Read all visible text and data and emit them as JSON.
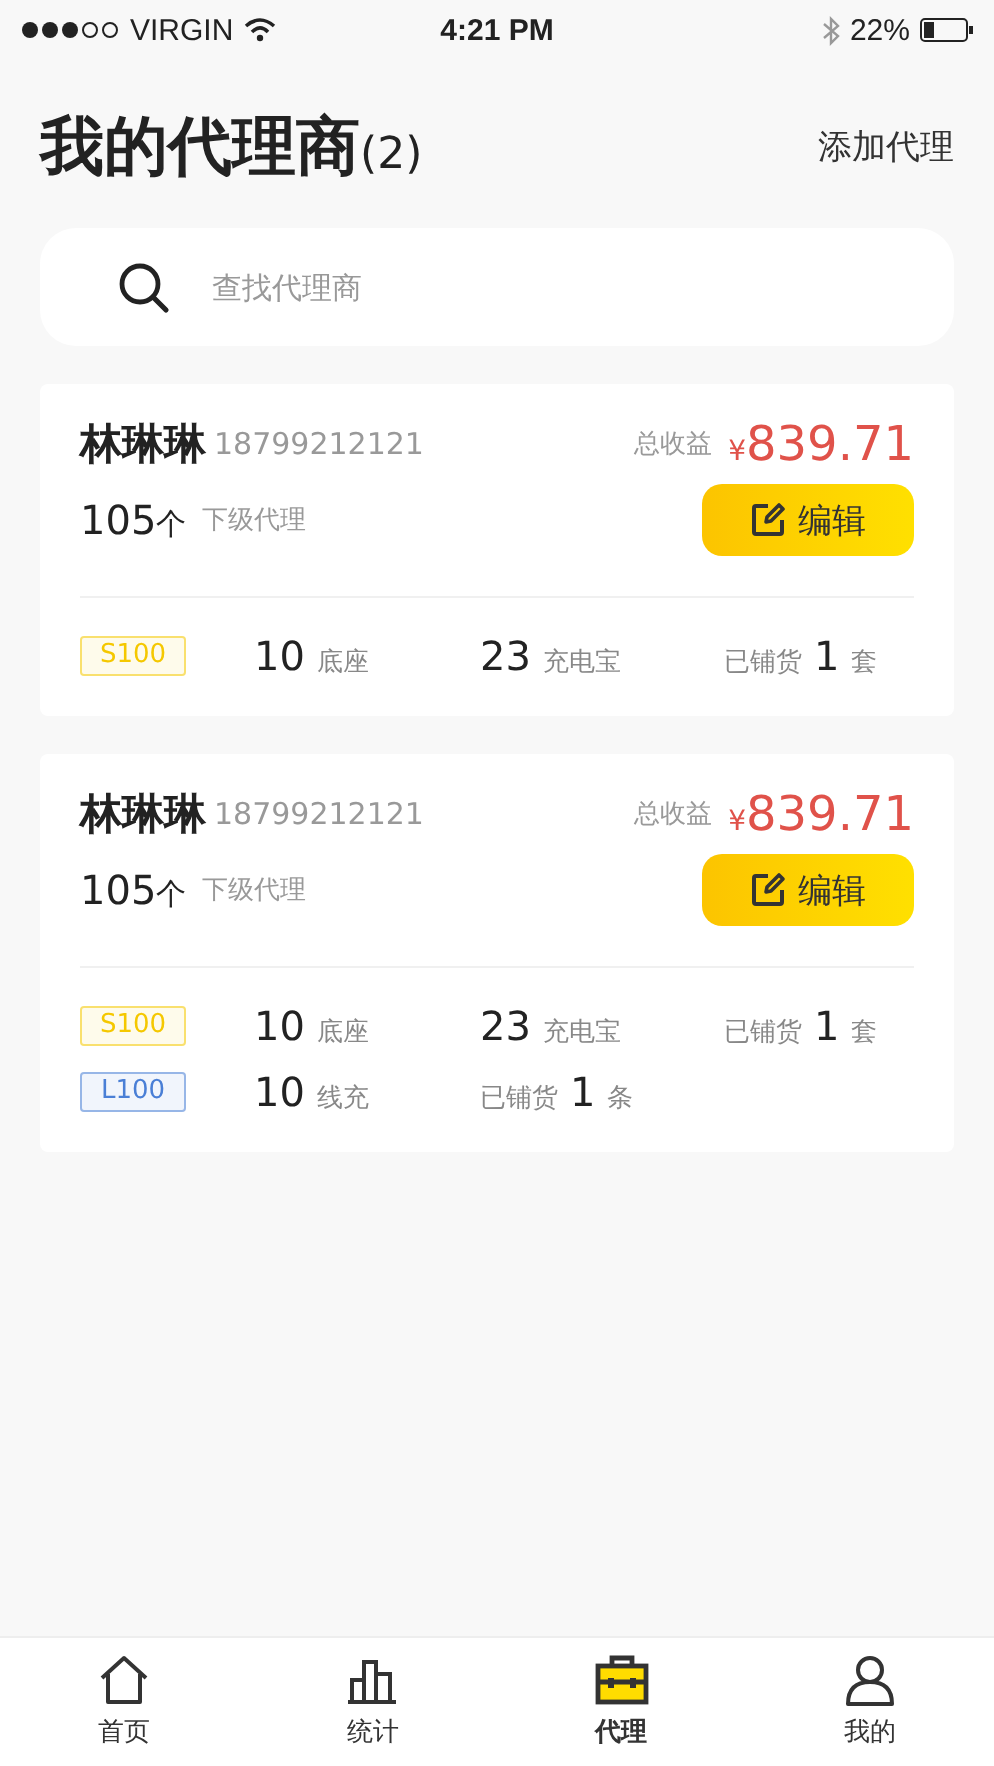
{
  "status_bar": {
    "carrier": "VIRGIN",
    "time": "4:21 PM",
    "battery": "22%"
  },
  "header": {
    "title": "我的代理商",
    "count": "(2)",
    "action": "添加代理"
  },
  "search": {
    "placeholder": "查找代理商"
  },
  "agents": [
    {
      "name": "林琳琳",
      "phone": "18799212121",
      "earnings_label": "总收益",
      "currency": "¥",
      "earnings": "839.71",
      "sub_count": "105",
      "sub_unit": "个",
      "sub_label": "下级代理",
      "edit_label": "编辑",
      "stock_rows": [
        {
          "tag": "S100",
          "color": "#f5c800",
          "stats": [
            {
              "value": "10",
              "unit": "底座"
            },
            {
              "value": "23",
              "unit": "充电宝"
            },
            {
              "prefix": "已铺货",
              "value": "1",
              "unit": "套"
            }
          ]
        }
      ]
    },
    {
      "name": "林琳琳",
      "phone": "18799212121",
      "earnings_label": "总收益",
      "currency": "¥",
      "earnings": "839.71",
      "sub_count": "105",
      "sub_unit": "个",
      "sub_label": "下级代理",
      "edit_label": "编辑",
      "stock_rows": [
        {
          "tag": "S100",
          "color": "#f5c800",
          "stats": [
            {
              "value": "10",
              "unit": "底座"
            },
            {
              "value": "23",
              "unit": "充电宝"
            },
            {
              "prefix": "已铺货",
              "value": "1",
              "unit": "套"
            }
          ]
        },
        {
          "tag": "L100",
          "color": "#4a7fd6",
          "stats": [
            {
              "value": "10",
              "unit": "线充"
            },
            {
              "prefix": "已铺货",
              "value": "1",
              "unit": "条"
            }
          ]
        }
      ]
    }
  ],
  "tabs": [
    {
      "kind": "home",
      "label": "首页",
      "selected": false
    },
    {
      "kind": "stats",
      "label": "统计",
      "selected": false
    },
    {
      "kind": "agent",
      "label": "代理",
      "selected": true
    },
    {
      "kind": "profile",
      "label": "我的",
      "selected": false
    }
  ]
}
